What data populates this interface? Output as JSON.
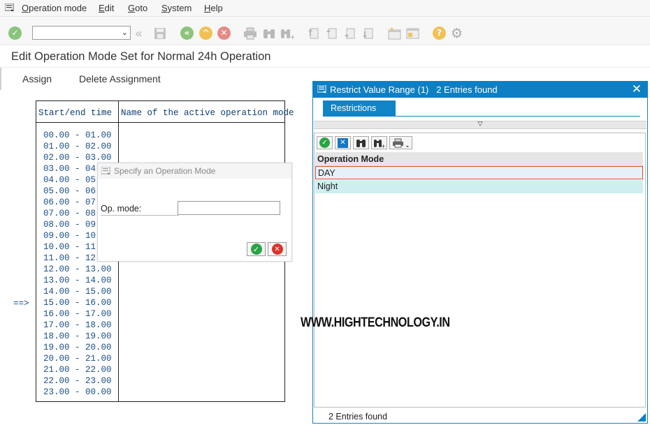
{
  "menubar": {
    "items": [
      "Operation mode",
      "Edit",
      "Goto",
      "System",
      "Help"
    ]
  },
  "toolbar": {
    "command_field_value": "",
    "icons": [
      "enter-icon",
      "command-dropdown",
      "back-double-icon",
      "save-icon",
      "back-icon",
      "exit-icon",
      "cancel-icon",
      "print-icon",
      "find-icon",
      "find-next-icon",
      "first-page-icon",
      "previous-page-icon",
      "next-page-icon",
      "last-page-icon",
      "create-session-icon",
      "shortcut-icon",
      "help-icon",
      "customize-icon"
    ]
  },
  "page": {
    "title": "Edit Operation Mode Set for Normal 24h Operation",
    "actions": [
      "Assign",
      "Delete Assignment"
    ]
  },
  "table": {
    "col1": "Start/end time",
    "col2": "Name of the active operation mode",
    "rows": [
      "00.00 - 01.00",
      "01.00 - 02.00",
      "02.00 - 03.00",
      "03.00 - 04.",
      "04.00 - 05.",
      "05.00 - 06.",
      "06.00 - 07.",
      "07.00 - 08.",
      "08.00 - 09.",
      "09.00 - 10.",
      "10.00 - 11.",
      "11.00 - 12.",
      "12.00 - 13.00",
      "13.00 - 14.00",
      "14.00 - 15.00",
      "15.00 - 16.00",
      "16.00 - 17.00",
      "17.00 - 18.00",
      "18.00 - 19.00",
      "19.00 - 20.00",
      "20.00 - 21.00",
      "21.00 - 22.00",
      "22.00 - 23.00",
      "23.00 - 00.00"
    ],
    "current_marker": "==>"
  },
  "specify_dialog": {
    "title": "Specify an Operation Mode",
    "label": "Op. mode:",
    "value": ""
  },
  "restrict_dialog": {
    "title": "Restrict Value Range (1)   2 Entries found",
    "tab": "Restrictions",
    "column": "Operation Mode",
    "rows": [
      "DAY",
      "Night"
    ],
    "footer": "2 Entries found",
    "divider_glyph": "▽"
  },
  "watermark": "WWW.HIGHTECHNOLOGY.IN",
  "colors": {
    "accent": "#0d7fc4",
    "ok_green": "#2aa345",
    "cancel_red": "#d9342b",
    "row_selected": "#e6f0f8",
    "row_alt": "#cfeef0"
  }
}
